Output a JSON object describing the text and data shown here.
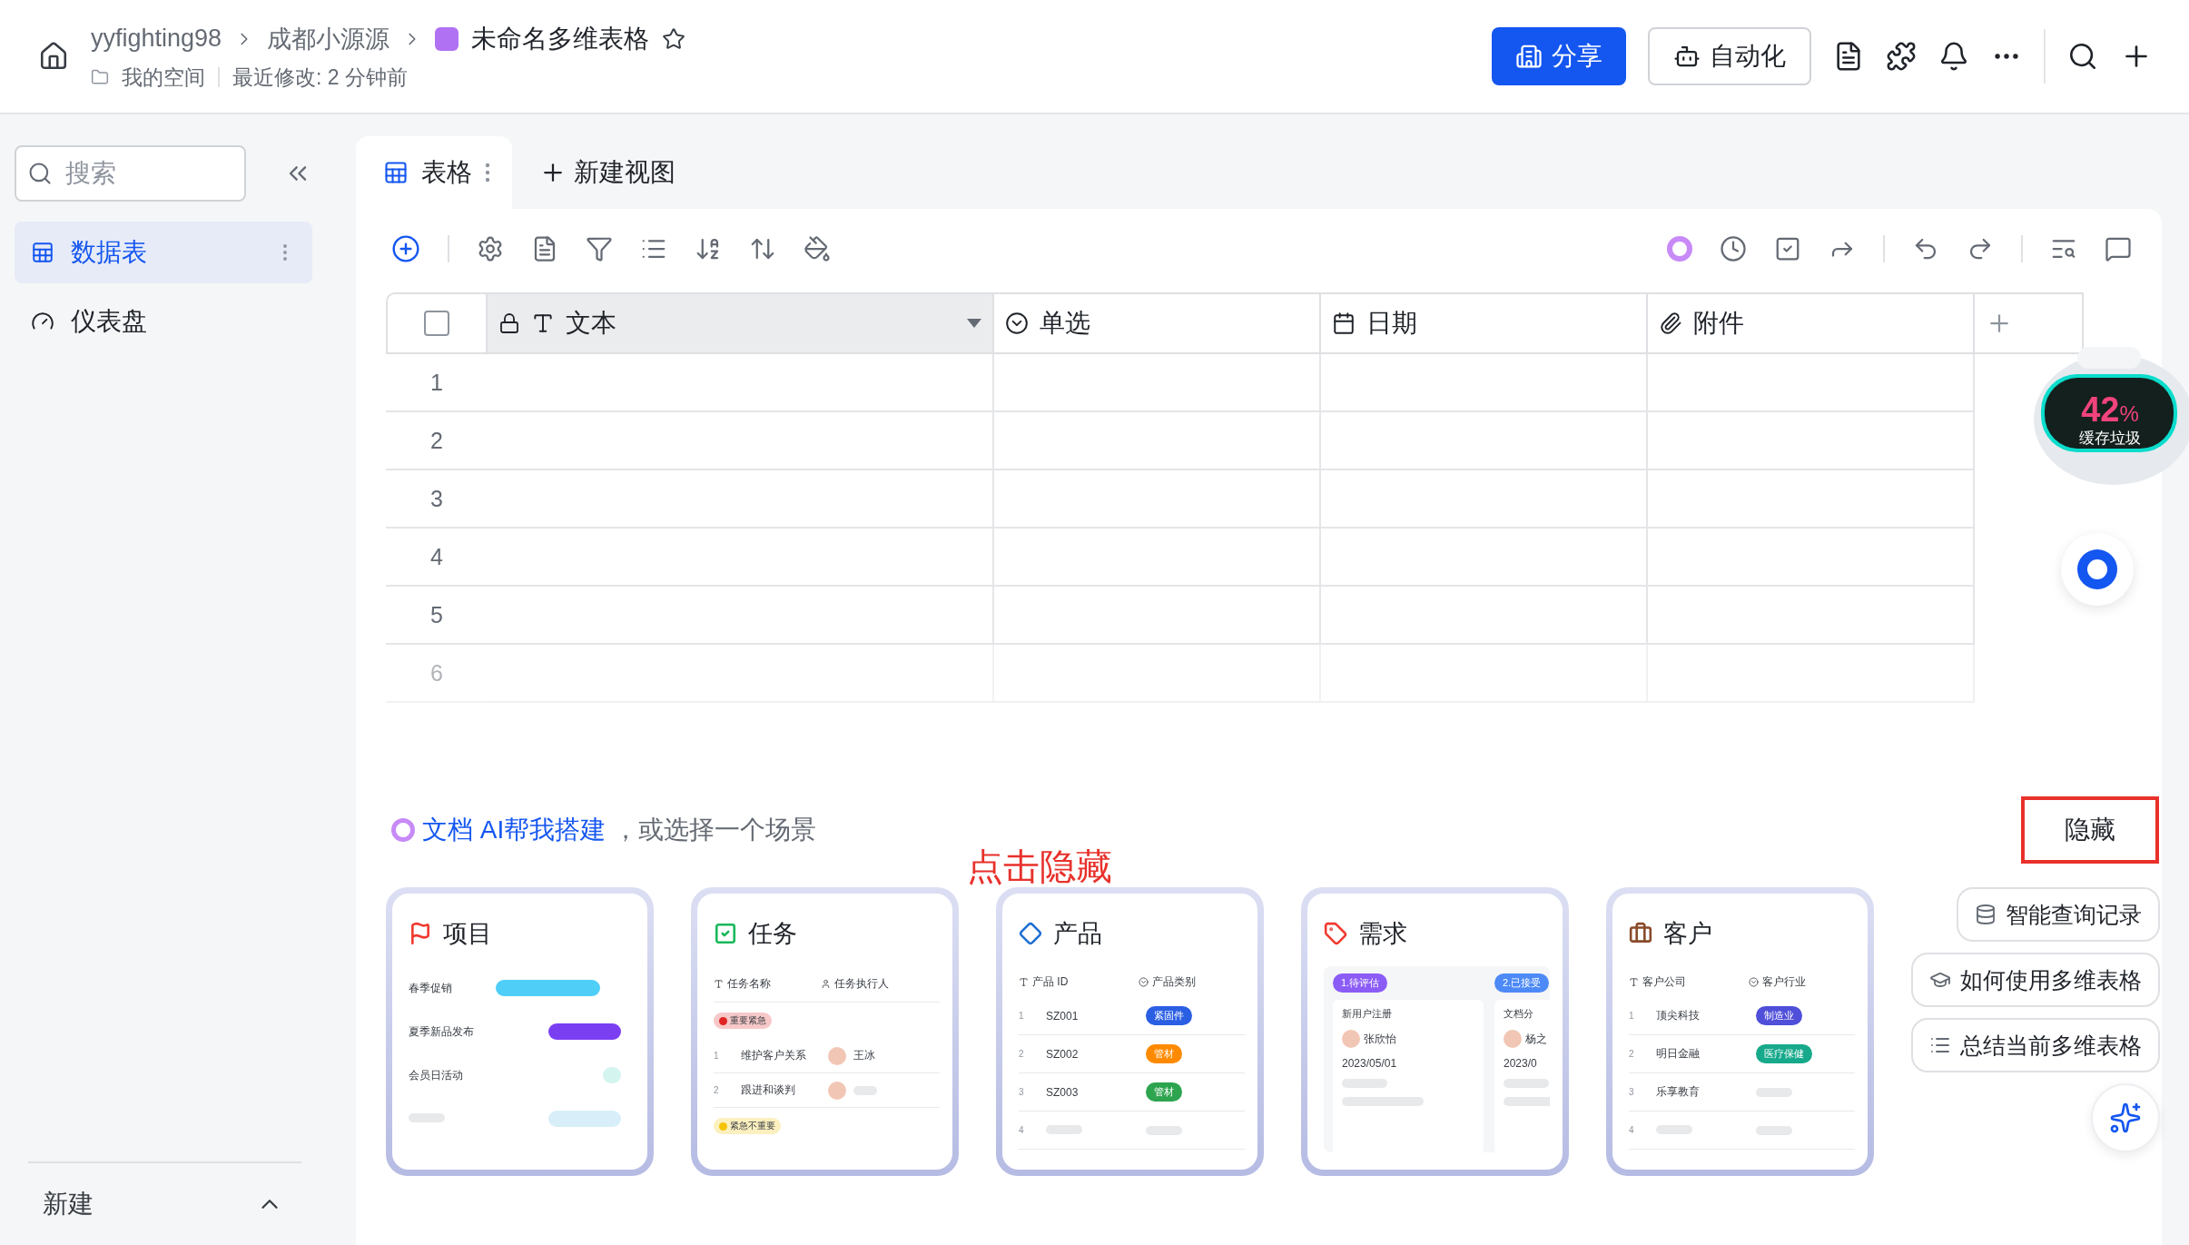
{
  "header": {
    "breadcrumb": [
      "yyfighting98",
      "成都小源源"
    ],
    "title": "未命名多维表格",
    "location": "我的空间",
    "modified": "最近修改: 2 分钟前",
    "share_button": "分享",
    "automation_button": "自动化"
  },
  "sidebar": {
    "search": {
      "placeholder": "搜索"
    },
    "items": [
      {
        "label": "数据表",
        "kind": "table",
        "selected": true
      },
      {
        "label": "仪表盘",
        "kind": "dashboard",
        "selected": false
      }
    ],
    "new_label": "新建"
  },
  "views": {
    "tabs": [
      {
        "label": "表格",
        "selected": true
      }
    ],
    "add_view": "新建视图"
  },
  "table": {
    "select_all": {
      "checked": false
    },
    "columns": [
      {
        "label": "文本",
        "kind": "text"
      },
      {
        "label": "单选",
        "kind": "select"
      },
      {
        "label": "日期",
        "kind": "date"
      },
      {
        "label": "附件",
        "kind": "attachment"
      }
    ],
    "rows": [
      "1",
      "2",
      "3",
      "4",
      "5",
      "6"
    ]
  },
  "scenes": {
    "ai_link": "文档 AI帮我搭建",
    "prompt": "，或选择一个场景",
    "hide_button": "隐藏",
    "annotation": "点击隐藏",
    "cards": [
      {
        "kind": "gantt",
        "title": "项目",
        "rows": [
          "春季促销",
          "夏季新品发布",
          "会员日活动"
        ]
      },
      {
        "kind": "task",
        "title": "任务",
        "columns": [
          "任务名称",
          "任务执行人"
        ],
        "groups": [
          {
            "label": "重要紧急",
            "color": "#e02424",
            "rows": [
              {
                "no": "1",
                "name": "维护客户关系",
                "assignee": "王冰"
              },
              {
                "no": "2",
                "name": "跟进和谈判"
              }
            ]
          },
          {
            "label": "紧急不重要",
            "color": "#f5c400"
          }
        ]
      },
      {
        "kind": "product",
        "title": "产品",
        "columns": [
          "产品 ID",
          "产品类别"
        ],
        "rows": [
          {
            "no": "1",
            "id": "SZ001",
            "tag": {
              "label": "紧固件",
              "color": "#2b5fe3"
            }
          },
          {
            "no": "2",
            "id": "SZ002",
            "tag": {
              "label": "管材",
              "color": "#ff8a00"
            }
          },
          {
            "no": "3",
            "id": "SZ003",
            "tag": {
              "label": "管材",
              "color": "#2ea44f"
            }
          },
          {
            "no": "4"
          }
        ]
      },
      {
        "kind": "kanban",
        "title": "需求",
        "stages": [
          {
            "label": "1.待评估",
            "color": "#8b5cf6",
            "card": {
              "title": "新用户注册",
              "person": "张欣怡",
              "date": "2023/05/01"
            }
          },
          {
            "label": "2.已接受",
            "color": "#4d8af7",
            "card": {
              "title": "文档分",
              "person": "杨之",
              "date": "2023/0"
            }
          }
        ]
      },
      {
        "kind": "customer",
        "title": "客户",
        "columns": [
          "客户公司",
          "客户行业"
        ],
        "rows": [
          {
            "no": "1",
            "company": "顶尖科技",
            "tag": {
              "label": "制造业",
              "color": "#4f4fd9"
            }
          },
          {
            "no": "2",
            "company": "明日金融",
            "tag": {
              "label": "医疗保健",
              "color": "#17a98b"
            }
          },
          {
            "no": "3",
            "company": "乐享教育"
          },
          {
            "no": "4"
          }
        ]
      }
    ]
  },
  "assistant": {
    "actions": [
      "智能查询记录",
      "如何使用多维表格",
      "总结当前多维表格"
    ]
  },
  "cleaner_widget": {
    "percent": "42",
    "unit": "%",
    "label": "缓存垃圾"
  }
}
